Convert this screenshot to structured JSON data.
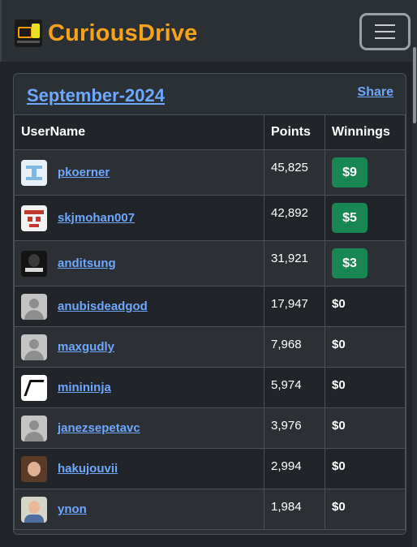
{
  "app": {
    "brand_name": "CuriousDrive",
    "brand_color": "#f7a21b",
    "accent": "#6ea8fe",
    "winning_badge_color": "#198754"
  },
  "nav": {
    "toggler_icon": "hamburger-icon"
  },
  "leaderboard": {
    "month": "September-2024",
    "share_label": "Share",
    "headers": {
      "username": "UserName",
      "points": "Points",
      "winnings": "Winnings"
    },
    "rows": [
      {
        "username": "pkoerner",
        "points": "45,825",
        "winnings": "$9",
        "badge": true,
        "avatar": "blue-pattern-avatar"
      },
      {
        "username": "skjmohan007",
        "points": "42,892",
        "winnings": "$5",
        "badge": true,
        "avatar": "red-pattern-avatar"
      },
      {
        "username": "anditsung",
        "points": "31,921",
        "winnings": "$3",
        "badge": true,
        "avatar": "photo-avatar"
      },
      {
        "username": "anubisdeadgod",
        "points": "17,947",
        "winnings": "$0",
        "badge": false,
        "avatar": "default-user-icon"
      },
      {
        "username": "maxgudly",
        "points": "7,968",
        "winnings": "$0",
        "badge": false,
        "avatar": "default-user-icon"
      },
      {
        "username": "minininja",
        "points": "5,974",
        "winnings": "$0",
        "badge": false,
        "avatar": "ninja-avatar"
      },
      {
        "username": "janezsepetavc",
        "points": "3,976",
        "winnings": "$0",
        "badge": false,
        "avatar": "default-user-icon"
      },
      {
        "username": "hakujouvii",
        "points": "2,994",
        "winnings": "$0",
        "badge": false,
        "avatar": "photo-avatar"
      },
      {
        "username": "ynon",
        "points": "1,984",
        "winnings": "$0",
        "badge": false,
        "avatar": "photo-avatar"
      }
    ]
  }
}
